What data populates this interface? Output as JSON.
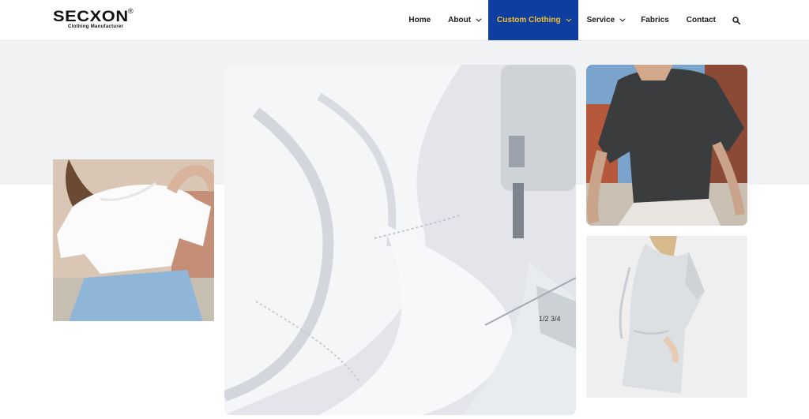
{
  "brand": {
    "name": "SECXON",
    "registered": "®",
    "tagline": "Clothing Manufacturer"
  },
  "nav": {
    "items": [
      {
        "label": "Home"
      },
      {
        "label": "About"
      },
      {
        "label": "Custom Clothing"
      },
      {
        "label": "Service"
      },
      {
        "label": "Fabrics"
      },
      {
        "label": "Contact"
      }
    ],
    "active_color": "#0f3ea3",
    "active_text_color": "#f4c22b"
  },
  "gallery": {
    "images": [
      {
        "icon": "woman-white-crop-tee-photo"
      },
      {
        "icon": "sewing-machine-white-fabric-photo"
      },
      {
        "icon": "dark-oversized-tee-photo"
      },
      {
        "icon": "light-long-tee-dress-photo"
      }
    ]
  }
}
